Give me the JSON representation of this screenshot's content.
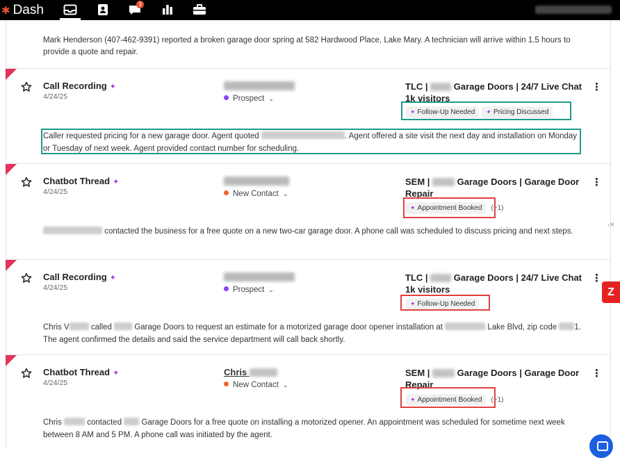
{
  "app": {
    "name": "Dash",
    "sms_badge": "3"
  },
  "top_summary": "Mark Henderson (407-462-9391) reported a broken garage door spring at 582 Hardwood Place, Lake Mary. A technician will arrive within 1.5 hours to provide a quote and repair.",
  "items": [
    {
      "type": "Call Recording",
      "date": "4/24/25",
      "status": "Prospect",
      "status_color": "#8a3ffc",
      "source_a": "TLC | ",
      "source_b": " Garage Doors | 24/7 Live Chat 1k visitors",
      "tags": [
        "Follow-Up Needed",
        "Pricing Discussed"
      ],
      "extra": "",
      "summary_a": "Caller requested pricing for a new garage door. Agent quoted ",
      "summary_b": ". Agent offered a site visit the next day and installation on Monday or Tuesday of next week. Agent provided contact number for scheduling."
    },
    {
      "type": "Chatbot Thread",
      "date": "4/24/25",
      "status": "New Contact",
      "status_color": "#f0622f",
      "source_a": "SEM | ",
      "source_b": " Garage Doors | Garage Door Repair",
      "tags": [
        "Appointment Booked"
      ],
      "extra": "(+1)",
      "summary_a": "",
      "summary_b": " contacted the business for a free quote on a new two-car garage door. A phone call was scheduled to discuss pricing and next steps."
    },
    {
      "type": "Call Recording",
      "date": "4/24/25",
      "status": "Prospect",
      "status_color": "#8a3ffc",
      "source_a": "TLC | ",
      "source_b": " Garage Doors | 24/7 Live Chat 1k visitors",
      "tags": [
        "Follow-Up Needed"
      ],
      "extra": "",
      "summary_a": "Chris V",
      "summary_b": " called ",
      "summary_c": " Garage Doors to request an estimate for a motorized garage door opener installation at ",
      "summary_d": " Lake Blvd, zip code ",
      "summary_e": "1. The agent confirmed the details and said the service department will call back shortly."
    },
    {
      "type": "Chatbot Thread",
      "date": "4/24/25",
      "contact_first": "Chris",
      "status": "New Contact",
      "status_color": "#f0622f",
      "source_a": "SEM | ",
      "source_b": " Garage Doors | Garage Door Repair",
      "tags": [
        "Appointment Booked"
      ],
      "extra": "(+1)",
      "summary_a": "Chris ",
      "summary_b": " contacted ",
      "summary_c": " Garage Doors for a free quote on installing a motorized opener. An appointment was scheduled for sometime next week between 8 AM and 5 PM. A phone call was initiated by the agent."
    }
  ]
}
